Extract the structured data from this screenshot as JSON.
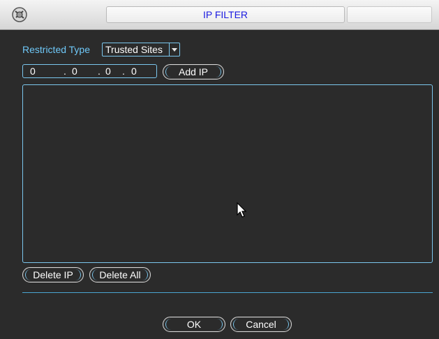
{
  "window": {
    "title": "IP FILTER"
  },
  "icons": {
    "app": "app-logo-icon",
    "cursor": "mouse-pointer-icon"
  },
  "restricted": {
    "label": "Restricted Type",
    "value": "Trusted Sites"
  },
  "ip": {
    "octets": [
      "0",
      "0",
      "0",
      "0"
    ],
    "sep": "."
  },
  "buttons": {
    "add_ip": "Add IP",
    "delete_ip": "Delete IP",
    "delete_all": "Delete All",
    "ok": "OK",
    "cancel": "Cancel"
  },
  "colors": {
    "accent": "#7bc7ee",
    "title_text": "#1a1ae0",
    "background": "#2b2b2b"
  }
}
